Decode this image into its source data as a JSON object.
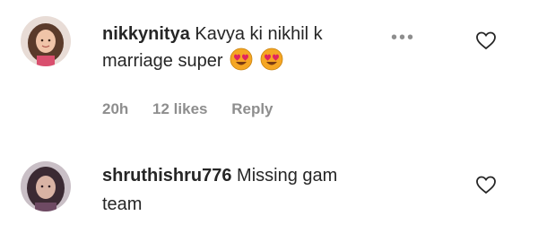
{
  "comments": [
    {
      "username": "nikkynitya",
      "text_line1": "Kavya ki nikhil k",
      "text_line2": "marriage super",
      "emojis": [
        "heart-eyes-emoji",
        "heart-eyes-emoji"
      ],
      "more": "•••",
      "time": "20h",
      "likes": "12 likes",
      "reply": "Reply"
    },
    {
      "username": "shruthishru776",
      "text_line1": "Missing gam",
      "text_line2": "team"
    }
  ],
  "colors": {
    "text": "#262626",
    "muted": "#8e8e8e"
  }
}
